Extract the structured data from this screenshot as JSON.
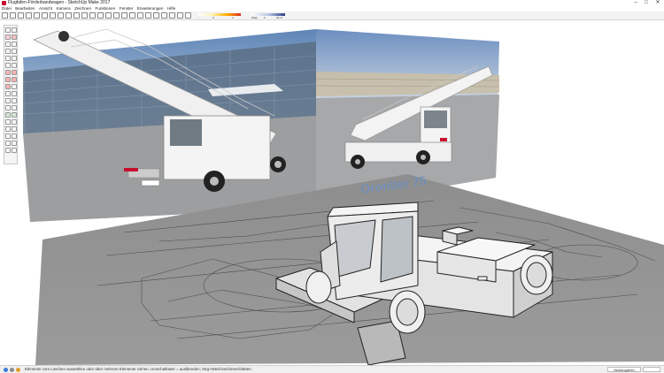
{
  "window": {
    "title": "Flugfafen-Förderbandwagen - SketchUp Make 2017",
    "min": "–",
    "max": "□",
    "close": "✕"
  },
  "menu": [
    "Datei",
    "Bearbeiten",
    "Ansicht",
    "Kamera",
    "Zeichnen",
    "Funktionen",
    "Fenster",
    "Erweiterungen",
    "Hilfe"
  ],
  "toolbar": {
    "ramp_labels": [
      "-",
      "0",
      "4",
      "Warp",
      "0",
      "20.17"
    ]
  },
  "model": {
    "text_3d": "Oroniter 75"
  },
  "statusbar": {
    "hint": "Elemente zum Löschen auswählen oder über mehrere Elemente ziehen. Umschalttaste = ausblenden; Strg+Weichzeichnen/Glätten.",
    "measure_label": "Maßangaben",
    "measure_value": ""
  },
  "colors": {
    "accent": "#c8102e",
    "ground": "#8a8a8a",
    "sky": "#a9c3da",
    "vehicle": "#f2f2f2"
  },
  "icons": [
    "app-icon",
    "select-icon",
    "eraser-icon",
    "pencil-icon",
    "rectangle-icon",
    "circle-icon",
    "push-pull-icon",
    "move-icon",
    "rotate-icon",
    "scale-icon",
    "offset-icon",
    "tape-measure-icon",
    "text-icon",
    "orbit-icon",
    "pan-icon",
    "zoom-icon",
    "zoom-extents-icon",
    "walk-icon",
    "position-camera-icon",
    "paint-bucket-icon"
  ]
}
